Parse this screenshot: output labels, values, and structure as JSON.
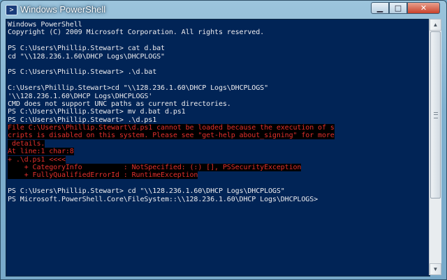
{
  "window": {
    "title": "Windows PowerShell",
    "icon": "powershell-icon",
    "controls": {
      "minimize": "▁",
      "maximize": "□",
      "close": "✕"
    }
  },
  "colors": {
    "console_bg": "#012456",
    "console_fg": "#eeedf0",
    "error_fg": "#e3302d",
    "error_bg": "#000000"
  },
  "console": {
    "lines": [
      {
        "text": "Windows PowerShell",
        "type": "normal"
      },
      {
        "text": "Copyright (C) 2009 Microsoft Corporation. All rights reserved.",
        "type": "normal"
      },
      {
        "text": "",
        "type": "normal"
      },
      {
        "text": "PS C:\\Users\\Phillip.Stewart> cat d.bat",
        "type": "normal"
      },
      {
        "text": "cd \"\\\\128.236.1.60\\DHCP Logs\\DHCPLOGS\"",
        "type": "normal"
      },
      {
        "text": "",
        "type": "normal"
      },
      {
        "text": "PS C:\\Users\\Phillip.Stewart> .\\d.bat",
        "type": "normal"
      },
      {
        "text": "",
        "type": "normal"
      },
      {
        "text": "C:\\Users\\Phillip.Stewart>cd \"\\\\128.236.1.60\\DHCP Logs\\DHCPLOGS\"",
        "type": "normal"
      },
      {
        "text": "'\\\\128.236.1.60\\DHCP Logs\\DHCPLOGS'",
        "type": "normal"
      },
      {
        "text": "CMD does not support UNC paths as current directories.",
        "type": "normal"
      },
      {
        "text": "PS C:\\Users\\Phillip.Stewart> mv d.bat d.ps1",
        "type": "normal"
      },
      {
        "text": "PS C:\\Users\\Phillip.Stewart> .\\d.ps1",
        "type": "normal"
      },
      {
        "text": "File C:\\Users\\Phillip.Stewart\\d.ps1 cannot be loaded because the execution of s",
        "type": "error"
      },
      {
        "text": "cripts is disabled on this system. Please see \"get-help about_signing\" for more",
        "type": "error"
      },
      {
        "text": " details.",
        "type": "error"
      },
      {
        "text": "At line:1 char:8",
        "type": "error"
      },
      {
        "text": "+ .\\d.ps1 <<<<",
        "type": "error"
      },
      {
        "text": "    + CategoryInfo          : NotSpecified: (:) [], PSSecurityException",
        "type": "error"
      },
      {
        "text": "    + FullyQualifiedErrorId : RuntimeException",
        "type": "error"
      },
      {
        "text": "",
        "type": "normal"
      },
      {
        "text": "PS C:\\Users\\Phillip.Stewart> cd \"\\\\128.236.1.60\\DHCP Logs\\DHCPLOGS\"",
        "type": "normal"
      },
      {
        "text": "PS Microsoft.PowerShell.Core\\FileSystem::\\\\128.236.1.60\\DHCP Logs\\DHCPLOGS>",
        "type": "normal"
      }
    ]
  },
  "scrollbar": {
    "up": "▲",
    "down": "▼"
  }
}
